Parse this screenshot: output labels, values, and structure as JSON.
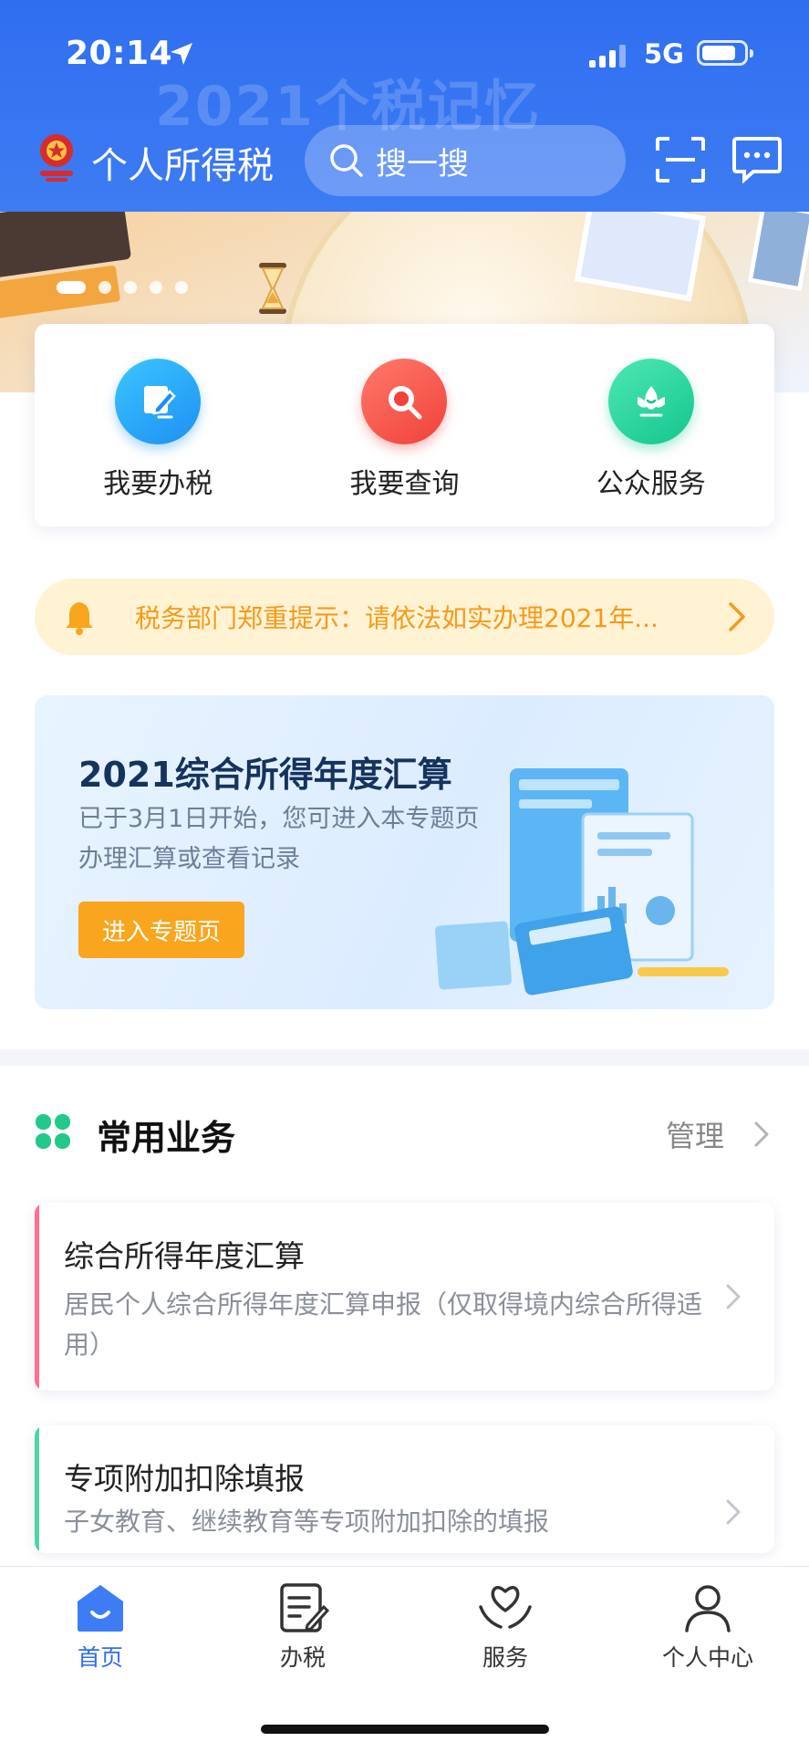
{
  "status_bar": {
    "time": "20:14",
    "network": "5G"
  },
  "header": {
    "banner_watermark": "2021个税记忆",
    "app_title": "个人所得税",
    "search_placeholder": "搜一搜"
  },
  "banner": {
    "slide_count": 5,
    "active_slide": 0
  },
  "quick_actions": [
    {
      "label": "我要办税",
      "icon": "edit-icon",
      "color": "#1e8ff2"
    },
    {
      "label": "我要查询",
      "icon": "search-icon",
      "color": "#f0413a"
    },
    {
      "label": "公众服务",
      "icon": "lotus-icon",
      "color": "#14c58e"
    }
  ],
  "notice": {
    "text": "税务部门郑重提示：请依法如实办理2021年..."
  },
  "promo": {
    "title": "2021综合所得年度汇算",
    "description": "已于3月1日开始，您可进入本专题页办理汇算或查看记录",
    "button_label": "进入专题页"
  },
  "common_business": {
    "title": "常用业务",
    "manage_label": "管理",
    "items": [
      {
        "name": "综合所得年度汇算",
        "description": "居民个人综合所得年度汇算申报（仅取得境内综合所得适用）",
        "accent": "#ff6f8e"
      },
      {
        "name": "专项附加扣除填报",
        "description": "子女教育、继续教育等专项附加扣除的填报",
        "accent": "#4fd6a0"
      }
    ]
  },
  "tabs": [
    {
      "label": "首页",
      "icon": "home-icon",
      "active": true
    },
    {
      "label": "办税",
      "icon": "document-edit-icon",
      "active": false
    },
    {
      "label": "服务",
      "icon": "heart-hands-icon",
      "active": false
    },
    {
      "label": "个人中心",
      "icon": "user-icon",
      "active": false
    }
  ],
  "colors": {
    "primary": "#2f6ef0",
    "notice_text": "#f59a1a",
    "promo_button": "#f9a51d"
  }
}
